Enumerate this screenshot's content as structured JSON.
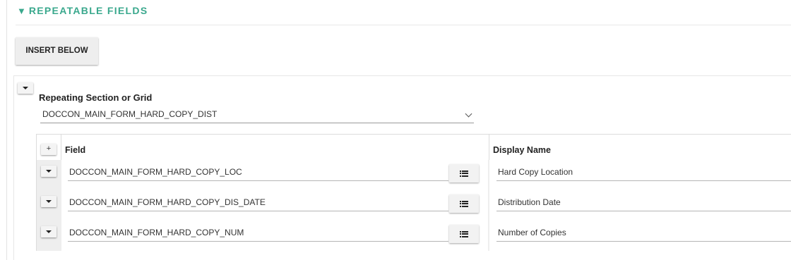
{
  "section": {
    "title": "REPEATABLE FIELDS",
    "collapse_glyph": "▼",
    "insert_below_label": "INSERT BELOW"
  },
  "repeat": {
    "label": "Repeating Section or Grid",
    "selected_value": "DOCCON_MAIN_FORM_HARD_COPY_DIST"
  },
  "grid": {
    "add_label": "+",
    "columns": {
      "field": "Field",
      "display_name": "Display Name"
    },
    "rows": [
      {
        "field": "DOCCON_MAIN_FORM_HARD_COPY_LOC",
        "display_name": "Hard Copy Location"
      },
      {
        "field": "DOCCON_MAIN_FORM_HARD_COPY_DIS_DATE",
        "display_name": "Distribution Date"
      },
      {
        "field": "DOCCON_MAIN_FORM_HARD_COPY_NUM",
        "display_name": "Number of Copies"
      }
    ]
  },
  "colors": {
    "accent": "#3aa88d",
    "row_background": "#eeeeee"
  },
  "icons": {
    "collapse": "caret-down-icon",
    "list": "list-icon",
    "select": "chevron-down-icon"
  }
}
